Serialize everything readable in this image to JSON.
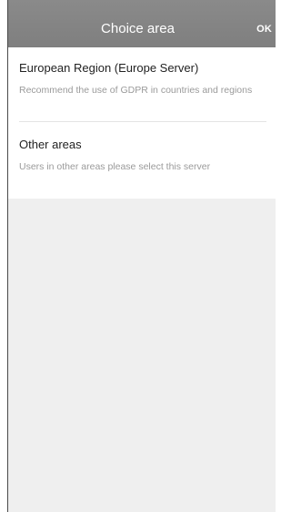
{
  "header": {
    "title": "Choice area",
    "ok_label": "OK"
  },
  "regions": [
    {
      "title": "European Region (Europe Server)",
      "description": "Recommend the use of GDPR in countries and regions"
    },
    {
      "title": "Other areas",
      "description": "Users in other areas please select this server"
    }
  ],
  "colors": {
    "header_background": "#858585",
    "page_background": "#efefef",
    "title_text": "#222222",
    "description_text": "#9a9a9a"
  }
}
